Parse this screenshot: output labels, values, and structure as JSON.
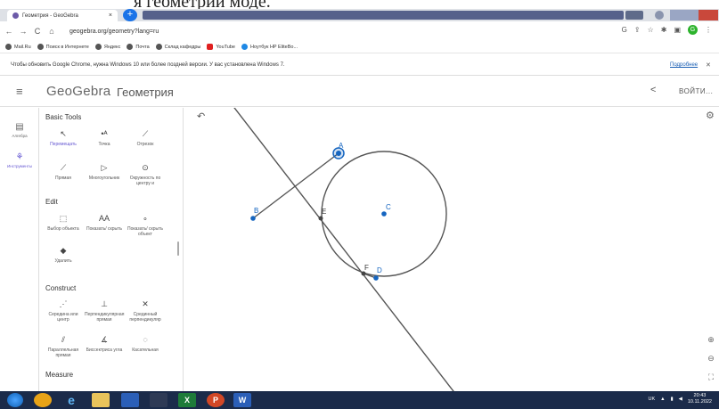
{
  "browser": {
    "tab_title": "Геометрия - GeoGebra",
    "tab_close": "×",
    "new_tab": "+",
    "url": "geogebra.org/geometry?lang=ru",
    "nav": {
      "back": "←",
      "forward": "→",
      "reload": "C",
      "home": "⌂",
      "lock": "🔒"
    },
    "profile_initial": "G"
  },
  "top_crop_text": "я геометрий моде.",
  "bookmarks": [
    "Mail.Ru",
    "Поиск в Интернете",
    "Яндекс",
    "Почта",
    "Склад кафедры",
    "YouTube",
    "Ноутбук HP EliteBo..."
  ],
  "infobar": {
    "message": "Чтобы обновить Google Chrome, нужна Windows 10 или более поздней версии. У вас установлена Windows 7.",
    "link": "Подробнее",
    "close": "✕"
  },
  "header": {
    "logo": "GeoGebra",
    "app_name": "Геометрия",
    "login": "ВОЙТИ..."
  },
  "rail": {
    "algebra": "Алгебра",
    "tools": "Инструменты"
  },
  "tools": {
    "basic_title": "Basic Tools",
    "move": "Перемещать",
    "point": "Точка",
    "segment": "Отрезок",
    "line": "Прямая",
    "polygon": "Многоугольник",
    "circle": "Окружность по центру и",
    "edit_title": "Edit",
    "select": "Выбор объекта",
    "show_label": "Показать/ скрыть",
    "show_obj": "Показать/ скрыть объект",
    "delete": "Удалить",
    "construct_title": "Construct",
    "midpoint": "Середина или центр",
    "perpendicular": "Перпендикулярная прямая",
    "perp_bisector": "Срединный перпендикуляр",
    "parallel": "Параллельная прямая",
    "angle_bisector": "Биссектриса угла",
    "tangent": "Касательная",
    "measure_title": "Measure"
  },
  "canvas": {
    "points": {
      "A": "A",
      "B": "B",
      "C": "C",
      "D": "D",
      "E": "E",
      "F": "F"
    },
    "undo_icon": "↶",
    "settings_icon": "⚙",
    "zoom_in": "⊕",
    "zoom_out": "⊖",
    "fullscreen": "⛶"
  },
  "taskbar": {
    "lang": "UK",
    "time": "20:43",
    "date": "10.11.2022"
  },
  "colors": {
    "accent": "#6557d2",
    "point_blue": "#1565c0",
    "taskbar": "#1b2b4a"
  }
}
